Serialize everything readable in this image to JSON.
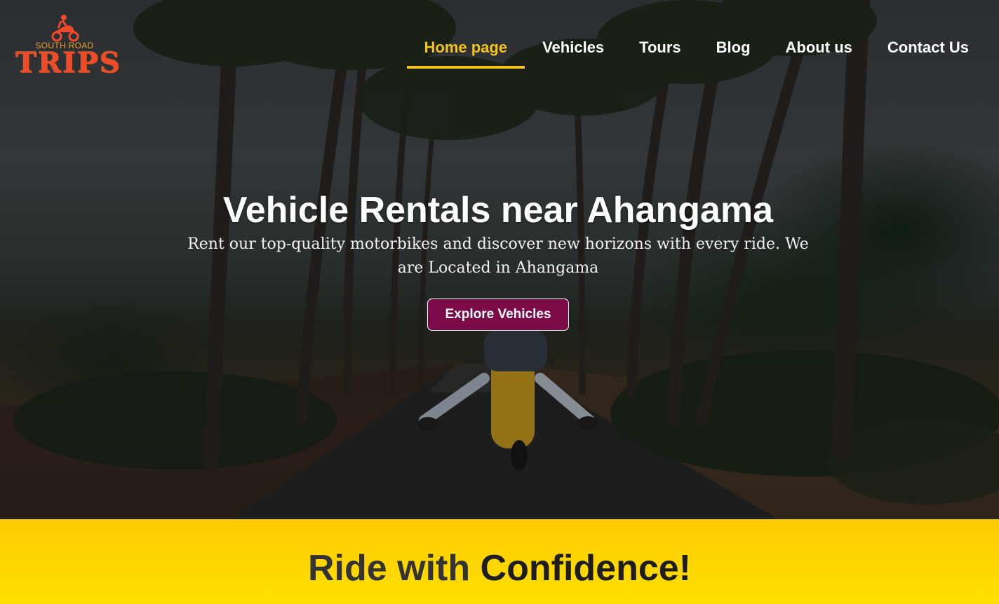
{
  "brand": {
    "logo_top": "SOUTH ROAD",
    "logo_main": "TRIPS",
    "logo_icon": "scooter-rider-icon",
    "colors": {
      "logo_orange": "#f04a2a",
      "accent_yellow": "#f5c21b"
    }
  },
  "nav": {
    "items": [
      {
        "label": "Home page",
        "active": true
      },
      {
        "label": "Vehicles",
        "active": false
      },
      {
        "label": "Tours",
        "active": false
      },
      {
        "label": "Blog",
        "active": false
      },
      {
        "label": "About us",
        "active": false
      },
      {
        "label": "Contact Us",
        "active": false
      }
    ]
  },
  "hero": {
    "title": "Vehicle Rentals near Ahangama",
    "subtitle": "Rent our top-quality motorbikes and discover new horizons with every ride. We are Located in Ahangama",
    "cta_label": "Explore Vehicles",
    "cta_color": "#7a0a48",
    "image_subject": "two riders on a yellow scooter on a palm-lined road"
  },
  "section": {
    "title_part1": "Ride with ",
    "title_part2": "Confidence!",
    "background": "#ffd400"
  }
}
